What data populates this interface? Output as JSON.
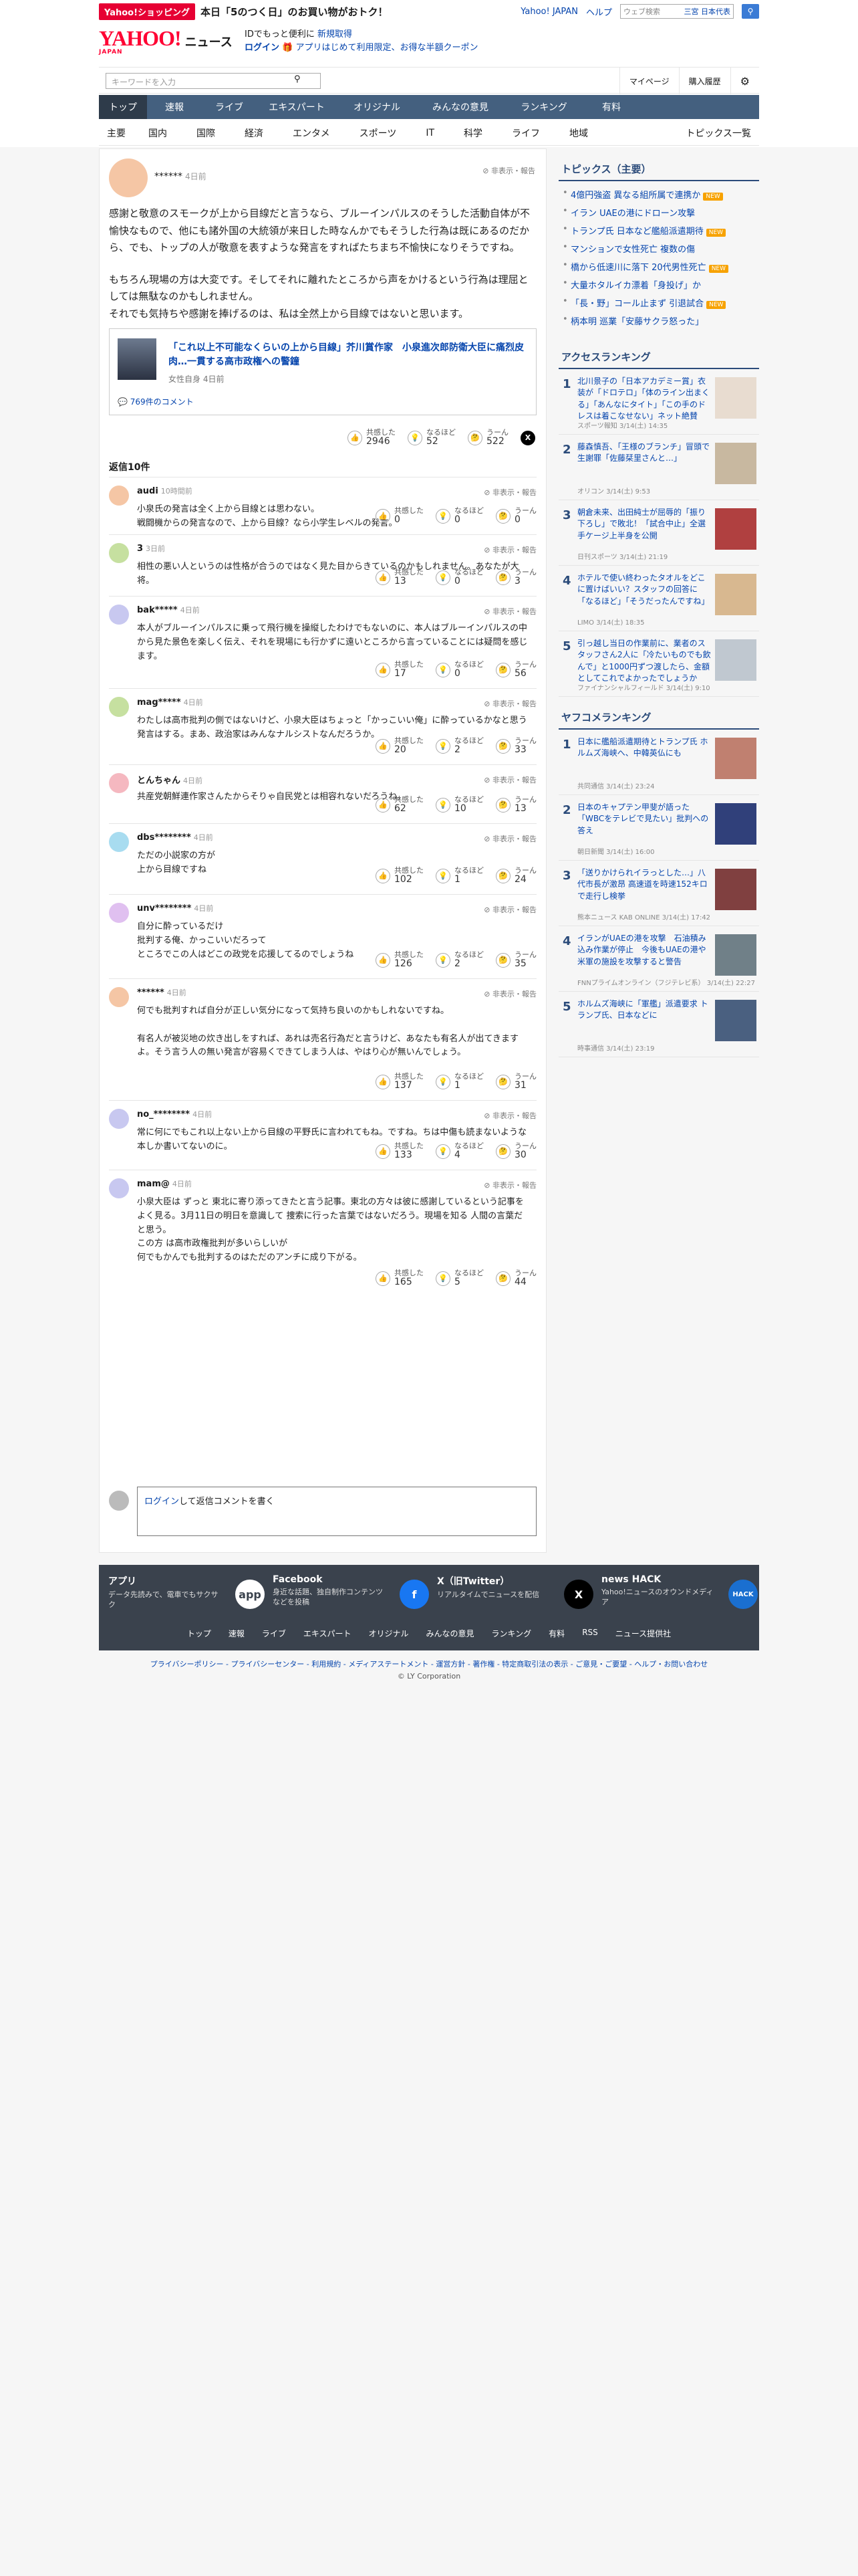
{
  "header": {
    "promo_tag": "Yahoo!ショッピング",
    "promo_text": "本日「5のつく日」のお買い物がおトク！",
    "links": [
      "Yahoo! JAPAN",
      "ヘルプ"
    ],
    "websearch_placeholder": "ウェブ検索",
    "websearch_scope": "三宮 日本代表",
    "logo_main": "YAHOO!",
    "logo_sub": "JAPAN",
    "logo_news": "ニュース",
    "login_line1": "IDでもっと便利に",
    "login_register": "新規取得",
    "login_link": "ログイン",
    "login_line2": "アプリはじめて利用限定、お得な半額クーポン",
    "keyword_placeholder": "キーワードを入力",
    "mypage": "マイページ",
    "history": "購入履歴"
  },
  "gnav": [
    "トップ",
    "速報",
    "ライブ",
    "エキスパート",
    "オリジナル",
    "みんなの意見",
    "ランキング",
    "有料"
  ],
  "snav": [
    "主要",
    "国内",
    "国際",
    "経済",
    "エンタメ",
    "スポーツ",
    "IT",
    "科学",
    "ライフ",
    "地域"
  ],
  "snav_right": "トピックス一覧",
  "top_comment": {
    "user": "******",
    "time": "4日前",
    "hide": "非表示・報告",
    "p1": "感謝と敬意のスモークが上から目線だと言うなら、ブルーインパルスのそうした活動自体が不愉快なもので、他にも諸外国の大統領が来日した時なんかでもそうした行為は既にあるのだから、でも、トップの人が敬意を表すような発言をすればたちまち不愉快になりそうですね。",
    "p2": "もちろん現場の方は大変です。そしてそれに離れたところから声をかけるという行為は理屈としては無駄なのかもしれません。",
    "p3": "それでも気持ちや感謝を捧げるのは、私は全然上から目線ではないと思います。",
    "article_title": "「これ以上不可能なくらいの上から目線」芥川賞作家　小泉進次郎防衛大臣に痛烈皮肉…一貫する高市政権への警鐘",
    "article_source": "女性自身",
    "article_time": "4日前",
    "article_comments": "769件のコメント",
    "reactions": {
      "empathy_label": "共感した",
      "empathy": "2946",
      "naruhodo_label": "なるほど",
      "naruhodo": "52",
      "uun_label": "うーん",
      "uun": "522"
    }
  },
  "reply_count": "返信10件",
  "replies": [
    {
      "user": "audi",
      "time": "10時間前",
      "text": "小泉氏の発言は全く上から目線とは思わない。\n戦闘機からの発言なので、上から目線？なら小学生レベルの発言。",
      "empathy": "0",
      "naruhodo": "0",
      "uun": "0"
    },
    {
      "user": "3",
      "time": "3日前",
      "text": "相性の悪い人というのは性格が合うのではなく見た目からきているのかもしれません。あなたが大将。",
      "empathy": "13",
      "naruhodo": "0",
      "uun": "3"
    },
    {
      "user": "bak*****",
      "time": "4日前",
      "text": "本人がブルーインパルスに乗って飛行機を操縦したわけでもないのに、本人はブルーインパルスの中から見た景色を楽しく伝え、それを現場にも行かずに遠いところから言っていることには疑問を感じます。",
      "empathy": "17",
      "naruhodo": "0",
      "uun": "56"
    },
    {
      "user": "mag*****",
      "time": "4日前",
      "text": "わたしは高市批判の側ではないけど、小泉大臣はちょっと「かっこいい俺」に酔っているかなと思う発言はする。まあ、政治家はみんなナルシストなんだろうか。",
      "empathy": "20",
      "naruhodo": "2",
      "uun": "33"
    },
    {
      "user": "とんちゃん",
      "time": "4日前",
      "text": "共産党朝鮮連作家さんたからそりゃ自民党とは相容れないだろうね。",
      "empathy": "62",
      "naruhodo": "10",
      "uun": "13"
    },
    {
      "user": "dbs********",
      "time": "4日前",
      "text": "ただの小説家の方が\n上から目線ですね",
      "empathy": "102",
      "naruhodo": "1",
      "uun": "24"
    },
    {
      "user": "unv********",
      "time": "4日前",
      "text": "自分に酔っているだけ\n批判する俺、かっこいいだろって\nところでこの人はどこの政党を応援してるのでしょうね",
      "empathy": "126",
      "naruhodo": "2",
      "uun": "35"
    },
    {
      "user": "******",
      "time": "4日前",
      "text": "何でも批判すれば自分が正しい気分になって気持ち良いのかもしれないですね。\n\n有名人が被災地の炊き出しをすれば、あれは売名行為だと言うけど、あなたも有名人が出てきますよ。そう言う人の無い発言が容易くできてしまう人は、やはり心が無いんでしょう。",
      "empathy": "137",
      "naruhodo": "1",
      "uun": "31"
    },
    {
      "user": "no_********",
      "time": "4日前",
      "text": "常に何にでもこれ以上ない上から目線の平野氏に言われてもね。ですね。ちは中傷も読まないような本しか書いてないのに。",
      "empathy": "133",
      "naruhodo": "4",
      "uun": "30"
    },
    {
      "user": "mam@",
      "time": "4日前",
      "text": "小泉大臣は ずっと 東北に寄り添ってきたと言う記事。東北の方々は彼に感謝しているという記事をよく見る。3月11日の明日を意識して 捜索に行った言葉ではないだろう。現場を知る 人間の言葉だと思う。\nこの方 は高市政権批判が多いらしいが\n何でもかんでも批判するのはただのアンチに成り下がる。",
      "empathy": "165",
      "naruhodo": "5",
      "uun": "44"
    }
  ],
  "reply_form": {
    "login": "ログイン",
    "text": "して返信コメントを書く"
  },
  "reaction_labels": {
    "empathy": "共感した",
    "naruhodo": "なるほど",
    "uun": "うーん"
  },
  "sidebar": {
    "topics_title": "トピックス（主要）",
    "topics": [
      {
        "text": "4億円強盗 異なる組所属で連携か",
        "new": true
      },
      {
        "text": "イラン UAEの港にドローン攻撃",
        "new": false
      },
      {
        "text": "トランプ氏 日本など艦船派遣期待",
        "new": true
      },
      {
        "text": "マンションで女性死亡 複数の傷",
        "new": false
      },
      {
        "text": "橋から低速川に落下 20代男性死亡",
        "new": true
      },
      {
        "text": "大量ホタルイカ漂着「身投げ」か",
        "new": false
      },
      {
        "text": "「長・野」コール止まず 引退試合",
        "new": true
      },
      {
        "text": "柄本明 巡業「安藤サクラ怒った」",
        "new": false
      }
    ],
    "access_title": "アクセスランキング",
    "access": [
      {
        "n": "1",
        "t": "北川景子の「日本アカデミー賞」衣装が「ドロテロ」「体のライン出まくる」「あんなにタイト」「この手のドレスは着こなせない」ネット絶賛",
        "s": "スポーツ報知 3/14(土) 14:35",
        "color": "#e8dcd0"
      },
      {
        "n": "2",
        "t": "藤森慎吾、「王様のブランチ」冒頭で生謝罪「佐藤栞里さんと…」",
        "s": "オリコン 3/14(土) 9:53",
        "color": "#c8b8a0"
      },
      {
        "n": "3",
        "t": "朝倉未来、出田純士が屈辱的「振り下ろし」で敗北！「試合中止」全選手ケージ上半身を公開",
        "s": "日刊スポーツ 3/14(土) 21:19",
        "color": "#b04040"
      },
      {
        "n": "4",
        "t": "ホテルで使い終わったタオルをどこに置けばいい？スタッフの回答に「なるほど」「そうだったんですね」",
        "s": "LIMO 3/14(土) 18:35",
        "color": "#d8b890"
      },
      {
        "n": "5",
        "t": "引っ越し当日の作業前に、業者のスタッフさん2人に「冷たいものでも飲んで」と1000円ずつ渡したら、金額としてこれでよかったでしょうか",
        "s": "ファイナンシャルフィールド 3/14(土) 9:10",
        "color": "#c0c8d0"
      }
    ],
    "yafoco_title": "ヤフコメランキング",
    "yafoco": [
      {
        "n": "1",
        "t": "日本に艦船派遣期待とトランプ氏 ホルムズ海峡へ、中韓英仏にも",
        "s": "共同通信 3/14(土) 23:24",
        "color": "#c08070"
      },
      {
        "n": "2",
        "t": "日本のキャプテン甲斐が語った「WBCをテレビで見たい」批判への答え",
        "s": "朝日新聞 3/14(土) 16:00",
        "color": "#30407a"
      },
      {
        "n": "3",
        "t": "「送りかけられイラっとした…」八代市長が激昂 高速道を時速152キロで走行し検挙",
        "s": "熊本ニュース KAB ONLINE 3/14(土) 17:42",
        "color": "#804040"
      },
      {
        "n": "4",
        "t": "イランがUAEの港を攻撃　石油積み込み作業が停止　今後もUAEの港や米軍の施設を攻撃すると警告",
        "s": "FNNプライムオンライン（フジテレビ系） 3/14(土) 22:27",
        "color": "#708088"
      },
      {
        "n": "5",
        "t": "ホルムズ海峡に「軍艦」派遣要求 トランプ氏、日本などに",
        "s": "時事通信 3/14(土) 23:19",
        "color": "#4a6080"
      }
    ]
  },
  "footer": {
    "tiles": [
      {
        "h": "アプリ",
        "d": "データ先読みで、電車でもサクサク",
        "ic": "app"
      },
      {
        "h": "Facebook",
        "d": "身近な話題、独自制作コンテンツなどを投稿",
        "ic": "f"
      },
      {
        "h": "X（旧Twitter）",
        "d": "リアルタイムでニュースを配信",
        "ic": "X"
      },
      {
        "h": "news HACK",
        "d": "Yahoo!ニュースのオウンドメディア",
        "ic": "HACK"
      }
    ],
    "nav": [
      "トップ",
      "速報",
      "ライブ",
      "エキスパート",
      "オリジナル",
      "みんなの意見",
      "ランキング",
      "有料",
      "RSS",
      "ニュース提供社"
    ],
    "policy": "プライバシーポリシー - プライバシーセンター - 利用規約 - メディアステートメント - 運営方針 - 著作権 - 特定商取引法の表示 - ご意見・ご要望 - ヘルプ・お問い合わせ",
    "copyright": "© LY Corporation"
  },
  "colors": {
    "accent": "#44607f",
    "brand": "#ff0033"
  }
}
